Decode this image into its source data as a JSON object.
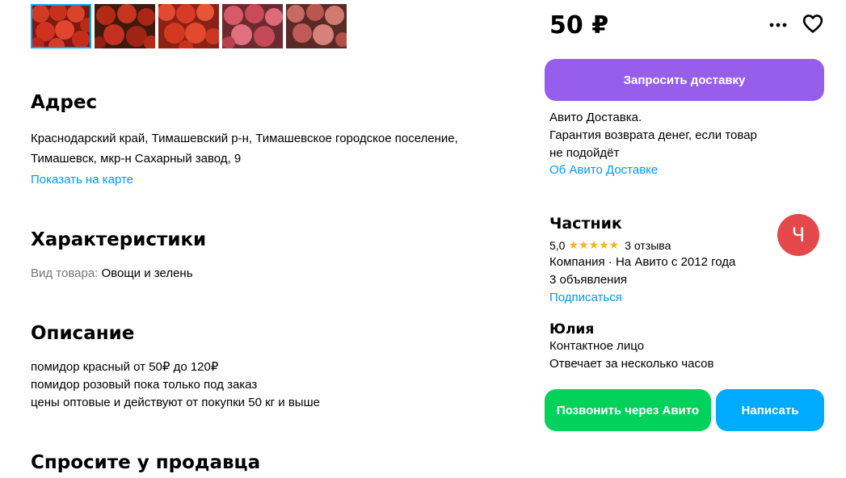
{
  "gallery": {
    "thumbnails": [
      {
        "alt": "tomatoes-1",
        "color": "#c8301f"
      },
      {
        "alt": "tomatoes-2",
        "color": "#a22616"
      },
      {
        "alt": "tomatoes-3",
        "color": "#d0331e"
      },
      {
        "alt": "tomatoes-4",
        "color": "#c54a56"
      },
      {
        "alt": "tomatoes-5",
        "color": "#c25a57"
      }
    ]
  },
  "address": {
    "title": "Адрес",
    "line1": "Краснодарский край, Тимашевский р-н, Тимашевское городское поселение,",
    "line2": "Тимашевск, мкр-н Сахарный завод, 9",
    "map_link": "Показать на карте"
  },
  "characteristics": {
    "title": "Характеристики",
    "items": [
      {
        "label": "Вид товара:",
        "value": "Овощи и зелень"
      }
    ]
  },
  "description": {
    "title": "Описание",
    "lines": [
      "помидор красный от 50₽ до 120₽",
      "помидор розовый пока только под заказ",
      "цены оптовые и действуют от покупки 50 кг и выше"
    ]
  },
  "ask_seller": {
    "title": "Спросите у продавца"
  },
  "sidebar": {
    "price": "50 ₽",
    "more_icon": "more-dots-icon",
    "fav_icon": "heart-icon",
    "delivery_button": "Запросить доставку",
    "delivery_info": {
      "line1": "Авито Доставка.",
      "line2": "Гарантия возврата денег, если товар",
      "line3": "не подойдёт",
      "link": "Об Авито Доставке"
    },
    "seller": {
      "name": "Частник",
      "avatar_letter": "Ч",
      "rating": "5,0",
      "stars": "★★★★★",
      "reviews": "3 отзыва",
      "company": "Компания · На Авито с 2012 года",
      "ads": "3 объявления",
      "subscribe": "Подписаться"
    },
    "contact": {
      "name": "Юлия",
      "role": "Контактное лицо",
      "response": "Отвечает за несколько часов"
    },
    "call_button": "Позвонить через Авито",
    "write_button": "Написать"
  },
  "colors": {
    "accent_link": "#0099f7",
    "purple": "#965eeb",
    "green": "#02d15c",
    "blue": "#00aaff",
    "avatar": "#e5484a",
    "star": "#ffb021"
  }
}
